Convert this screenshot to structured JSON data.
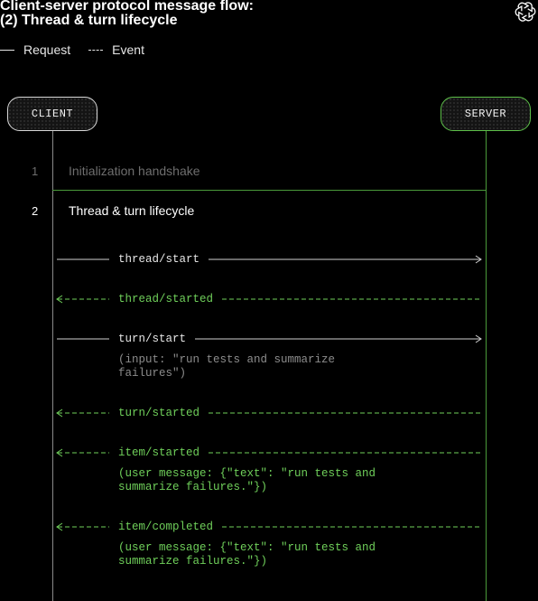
{
  "title": {
    "line1": "Client-server protocol message flow:",
    "line2": "(2) Thread & turn lifecycle"
  },
  "logo_icon": "openai-logo-icon",
  "legend": {
    "request": "Request",
    "event": "Event"
  },
  "participants": {
    "client": "CLIENT",
    "server": "SERVER"
  },
  "colors": {
    "background": "#000000",
    "request_line": "#d0d0d0",
    "event_green": "#6fcf5a",
    "server_border": "#5ec04a",
    "dim_text": "#6e6e6e"
  },
  "steps": [
    {
      "number": "1",
      "label": "Initialization handshake"
    },
    {
      "number": "2",
      "label": "Thread & turn lifecycle"
    }
  ],
  "messages": [
    {
      "kind": "request",
      "name": "thread/start"
    },
    {
      "kind": "event",
      "name": "thread/started"
    },
    {
      "kind": "request",
      "name": "turn/start",
      "detail": "(input: \"run tests and summarize\nfailures\")"
    },
    {
      "kind": "event",
      "name": "turn/started"
    },
    {
      "kind": "event",
      "name": "item/started",
      "detail": "(user message: {\"text\": \"run tests and\nsummarize failures.\"})"
    },
    {
      "kind": "event",
      "name": "item/completed",
      "detail": "(user message: {\"text\": \"run tests and\nsummarize failures.\"})"
    }
  ]
}
